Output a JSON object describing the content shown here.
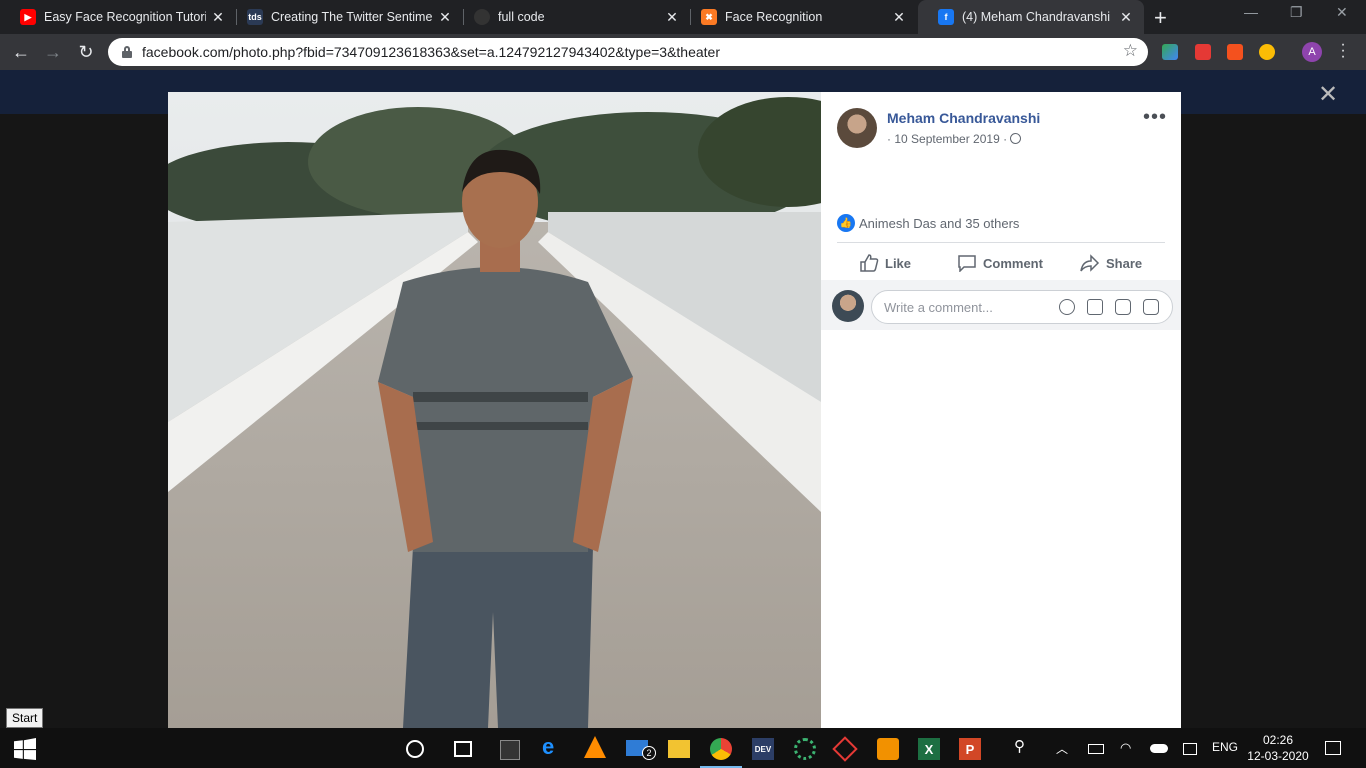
{
  "browser": {
    "tabs": [
      {
        "label": "Easy Face Recognition Tutorial",
        "favicon": "youtube-icon",
        "color": "#ff0000"
      },
      {
        "label": "Creating The Twitter Sentiment",
        "favicon": "tds-icon",
        "color": "#2b3a55",
        "text": "tds"
      },
      {
        "label": "full code",
        "favicon": "github-icon",
        "color": "#333333"
      },
      {
        "label": "Face Recognition",
        "favicon": "xampp-icon",
        "color": "#fb7a24"
      },
      {
        "label": "(4) Meham Chandravanshi",
        "favicon": "facebook-icon",
        "color": "#1877f2",
        "active": true
      }
    ],
    "url": "facebook.com/photo.php?fbid=734709123618363&set=a.124792127943402&type=3&theater",
    "profile_initial": "A"
  },
  "post": {
    "author": "Meham Chandravanshi",
    "date": "· 10 September 2019 ·",
    "reactions": "Animesh Das and 35 others",
    "actions": {
      "like": "Like",
      "comment": "Comment",
      "share": "Share"
    },
    "comment_placeholder": "Write a comment..."
  },
  "tooltip": "Start",
  "taskbar": {
    "language": "ENG",
    "time": "02:26",
    "date": "12-03-2020",
    "mail_badge": "2",
    "dev_label": "DEV"
  },
  "colors": {
    "fb_link": "#385898",
    "fb_blue": "#1877f2",
    "taskbar_accent": "#76b9ed"
  }
}
